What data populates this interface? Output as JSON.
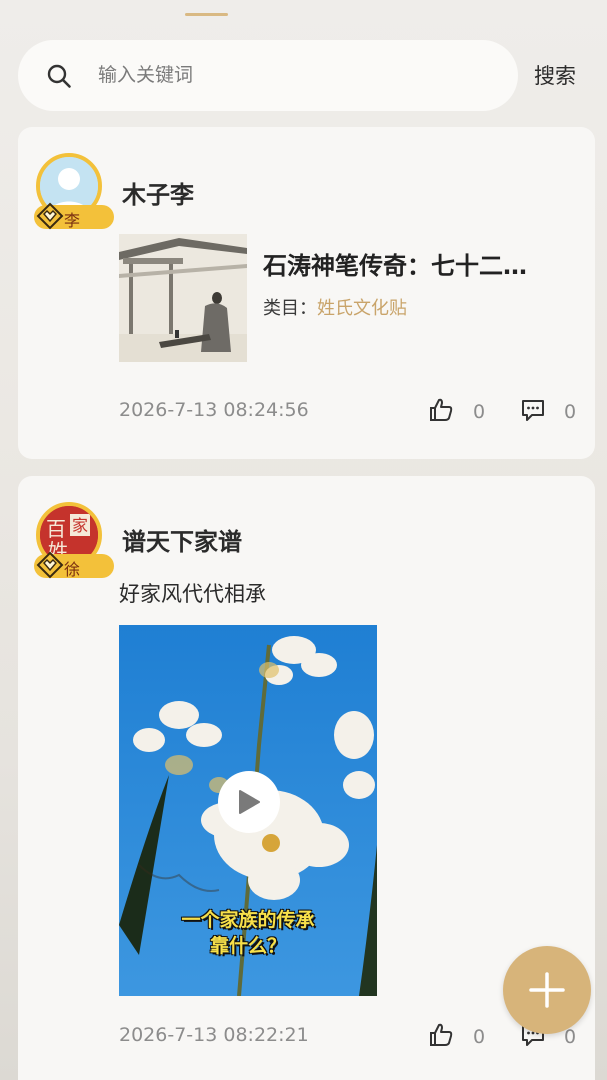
{
  "search": {
    "placeholder": "输入关键词",
    "value": "",
    "button_label": "搜索"
  },
  "posts": [
    {
      "username": "木子李",
      "badge_surname": "李",
      "title": "石涛神笔传奇：七十二…",
      "category_label": "类目：",
      "category_value": "姓氏文化贴",
      "timestamp": "2026-7-13 08:24:56",
      "likes": "0",
      "comments": "0"
    },
    {
      "username": "谱天下家谱",
      "badge_surname": "徐",
      "text": "好家风代代相承",
      "video_caption_line1": "一个家族的传承",
      "video_caption_line2": "靠什么？",
      "timestamp": "2026-7-13 08:22:21",
      "likes": "0",
      "comments": "0"
    }
  ],
  "icons": {
    "search": "search-icon",
    "like": "thumbs-up-icon",
    "comment": "comment-icon",
    "play": "play-icon",
    "add": "plus-icon",
    "badge": "diamond-icon"
  },
  "colors": {
    "accent_gold": "#d7b47a",
    "badge_yellow": "#f3c13a",
    "category_gold": "#c9a46a"
  }
}
